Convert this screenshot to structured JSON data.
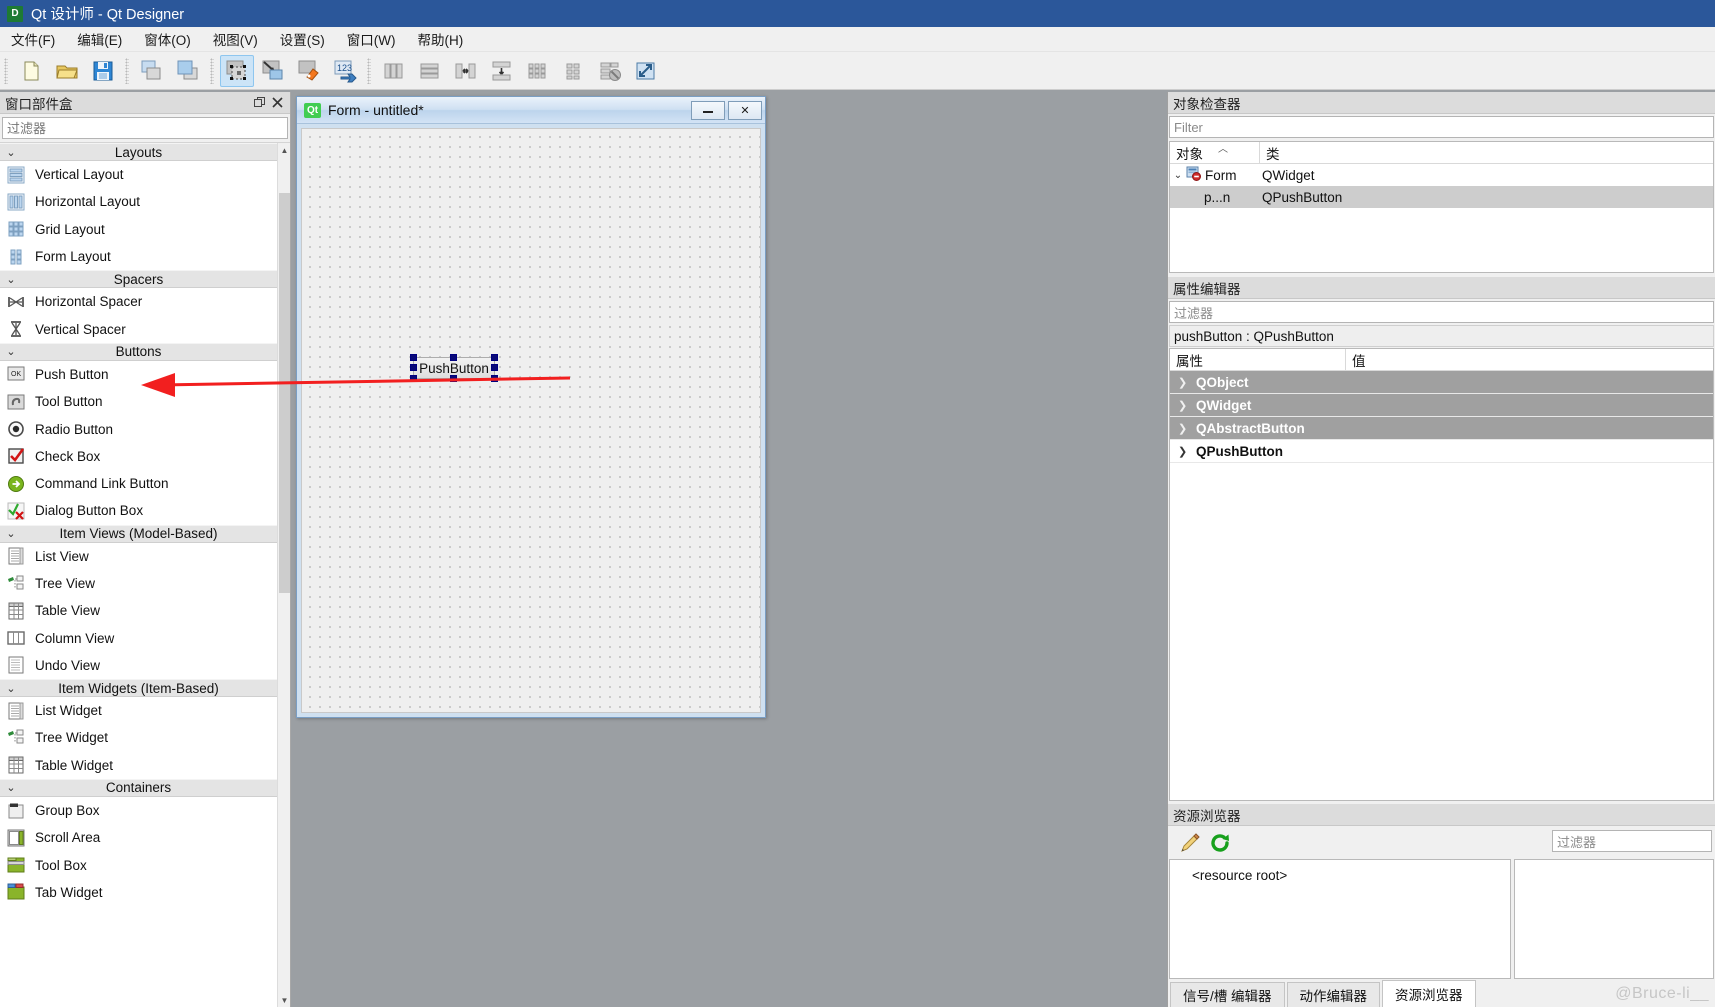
{
  "window": {
    "title": "Qt 设计师 - Qt Designer",
    "icon": "designer-app-icon",
    "badge_letter": "D"
  },
  "menubar": {
    "items": [
      {
        "label": "文件(F)",
        "name": "menu-file"
      },
      {
        "label": "编辑(E)",
        "name": "menu-edit"
      },
      {
        "label": "窗体(O)",
        "name": "menu-form"
      },
      {
        "label": "视图(V)",
        "name": "menu-view"
      },
      {
        "label": "设置(S)",
        "name": "menu-settings"
      },
      {
        "label": "窗口(W)",
        "name": "menu-window"
      },
      {
        "label": "帮助(H)",
        "name": "menu-help"
      }
    ]
  },
  "toolbar": {
    "groups": [
      {
        "name": "file-group",
        "buttons": [
          {
            "icon": "new-file-icon",
            "active": false
          },
          {
            "icon": "open-folder-icon",
            "active": false
          },
          {
            "icon": "save-icon",
            "active": false
          }
        ]
      },
      {
        "name": "form-group",
        "buttons": [
          {
            "icon": "undo-stack-icon",
            "active": false
          },
          {
            "icon": "redo-stack-icon",
            "active": false
          }
        ]
      },
      {
        "name": "mode-group",
        "buttons": [
          {
            "icon": "edit-widgets-mode-icon",
            "active": true
          },
          {
            "icon": "edit-signals-slots-mode-icon",
            "active": false
          },
          {
            "icon": "edit-buddies-mode-icon",
            "active": false
          },
          {
            "icon": "edit-tab-order-mode-icon",
            "active": false
          }
        ]
      },
      {
        "name": "layout-group",
        "buttons": [
          {
            "icon": "layout-horizontally-icon",
            "active": false
          },
          {
            "icon": "layout-vertically-icon",
            "active": false
          },
          {
            "icon": "layout-in-splitter-horizontal-icon",
            "active": false
          },
          {
            "icon": "layout-in-splitter-vertical-icon",
            "active": false
          },
          {
            "icon": "layout-grid-icon",
            "active": false
          },
          {
            "icon": "layout-form-icon",
            "active": false
          },
          {
            "icon": "break-layout-icon",
            "active": false
          },
          {
            "icon": "adjust-size-icon",
            "active": false
          }
        ]
      }
    ]
  },
  "widgetbox": {
    "title": "窗口部件盒",
    "float_button": "undock-icon",
    "close_button": "close-icon",
    "filter_placeholder": "过滤器",
    "filter_value": "",
    "sections": [
      {
        "name": "Layouts",
        "label": "Layouts",
        "expanded": true,
        "items": [
          {
            "label": "Vertical Layout",
            "icon": "vertical-layout-icon"
          },
          {
            "label": "Horizontal Layout",
            "icon": "horizontal-layout-icon"
          },
          {
            "label": "Grid Layout",
            "icon": "grid-layout-icon"
          },
          {
            "label": "Form Layout",
            "icon": "form-layout-icon"
          }
        ]
      },
      {
        "name": "Spacers",
        "label": "Spacers",
        "expanded": true,
        "items": [
          {
            "label": "Horizontal Spacer",
            "icon": "horizontal-spacer-icon"
          },
          {
            "label": "Vertical Spacer",
            "icon": "vertical-spacer-icon"
          }
        ]
      },
      {
        "name": "Buttons",
        "label": "Buttons",
        "expanded": true,
        "items": [
          {
            "label": "Push Button",
            "icon": "push-button-icon"
          },
          {
            "label": "Tool Button",
            "icon": "tool-button-icon"
          },
          {
            "label": "Radio Button",
            "icon": "radio-button-icon"
          },
          {
            "label": "Check Box",
            "icon": "check-box-icon"
          },
          {
            "label": "Command Link Button",
            "icon": "command-link-button-icon"
          },
          {
            "label": "Dialog Button Box",
            "icon": "dialog-button-box-icon"
          }
        ]
      },
      {
        "name": "Item Views (Model-Based)",
        "label": "Item Views (Model-Based)",
        "expanded": true,
        "items": [
          {
            "label": "List View",
            "icon": "list-view-icon"
          },
          {
            "label": "Tree View",
            "icon": "tree-view-icon"
          },
          {
            "label": "Table View",
            "icon": "table-view-icon"
          },
          {
            "label": "Column View",
            "icon": "column-view-icon"
          },
          {
            "label": "Undo View",
            "icon": "undo-view-icon"
          }
        ]
      },
      {
        "name": "Item Widgets (Item-Based)",
        "label": "Item Widgets (Item-Based)",
        "expanded": true,
        "items": [
          {
            "label": "List Widget",
            "icon": "list-widget-icon"
          },
          {
            "label": "Tree Widget",
            "icon": "tree-widget-icon"
          },
          {
            "label": "Table Widget",
            "icon": "table-widget-icon"
          }
        ]
      },
      {
        "name": "Containers",
        "label": "Containers",
        "expanded": true,
        "items": [
          {
            "label": "Group Box",
            "icon": "group-box-icon"
          },
          {
            "label": "Scroll Area",
            "icon": "scroll-area-icon"
          },
          {
            "label": "Tool Box",
            "icon": "tool-box-icon"
          },
          {
            "label": "Tab Widget",
            "icon": "tab-widget-icon"
          }
        ]
      }
    ]
  },
  "form_window": {
    "title": "Form - untitled*",
    "badge": "Qt",
    "minimize_label": "—",
    "close_label": "✕",
    "widgets": [
      {
        "type": "QPushButton",
        "label": "PushButton",
        "selected": true
      }
    ]
  },
  "object_inspector": {
    "title": "对象检查器",
    "filter_placeholder": "Filter",
    "columns": [
      "对象",
      "类"
    ],
    "rows": [
      {
        "object": "Form",
        "class": "QWidget",
        "level": 0,
        "expanded": true,
        "selected": false,
        "icon": "form-widget-icon"
      },
      {
        "object": "p...n",
        "class": "QPushButton",
        "level": 1,
        "expanded": false,
        "selected": true,
        "icon": ""
      }
    ]
  },
  "property_editor": {
    "title": "属性编辑器",
    "filter_placeholder": "过滤器",
    "object_header": "pushButton : QPushButton",
    "columns": [
      "属性",
      "值"
    ],
    "rows": [
      {
        "name": "QObject",
        "style": "grey",
        "expanded": false
      },
      {
        "name": "QWidget",
        "style": "grey",
        "expanded": false
      },
      {
        "name": "QAbstractButton",
        "style": "grey",
        "expanded": false
      },
      {
        "name": "QPushButton",
        "style": "white",
        "expanded": false
      }
    ]
  },
  "resource_browser": {
    "title": "资源浏览器",
    "edit_icon": "pencil-edit-icon",
    "reload_icon": "reload-refresh-icon",
    "filter_placeholder": "过滤器",
    "root_label": "<resource root>",
    "tabs": [
      {
        "label": "信号/槽 编辑器",
        "active": false
      },
      {
        "label": "动作编辑器",
        "active": false
      },
      {
        "label": "资源浏览器",
        "active": true
      }
    ]
  },
  "annotation": {
    "arrow_color": "#f21f1f",
    "target": "Push Button"
  },
  "watermark": "@Bruce-li__"
}
